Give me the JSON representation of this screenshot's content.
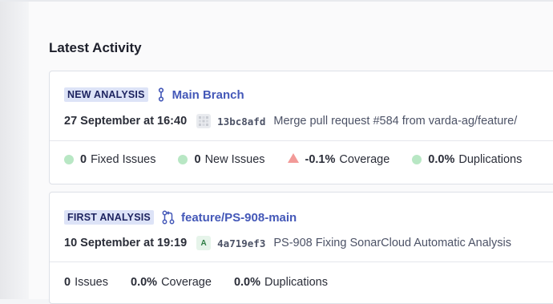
{
  "section_title": "Latest Activity",
  "colors": {
    "accent": "#4458b8",
    "badge_bg": "#dde3f7",
    "good": "#b8e7c4",
    "bad": "#f29a98"
  },
  "activities": [
    {
      "badge": "NEW ANALYSIS",
      "branch_icon": "main-branch-icon",
      "branch": "Main Branch",
      "date": "27 September at 16:40",
      "avatar": "identicon",
      "commit": "13bc8afd",
      "message": "Merge pull request #584 from varda-ag/feature/",
      "metrics": [
        {
          "icon": "green-dot-icon",
          "value": "0",
          "label": "Fixed Issues"
        },
        {
          "icon": "green-dot-icon",
          "value": "0",
          "label": "New Issues"
        },
        {
          "icon": "red-triangle-icon",
          "value": "-0.1%",
          "label": "Coverage"
        },
        {
          "icon": "green-dot-icon",
          "value": "0.0%",
          "label": "Duplications"
        }
      ]
    },
    {
      "badge": "FIRST ANALYSIS",
      "branch_icon": "pull-request-icon",
      "branch": "feature/PS-908-main",
      "date": "10 September at 19:19",
      "avatar": "A",
      "commit": "4a719ef3",
      "message": "PS-908 Fixing SonarCloud Automatic Analysis",
      "metrics": [
        {
          "value": "0",
          "label": "Issues"
        },
        {
          "value": "0.0%",
          "label": "Coverage"
        },
        {
          "value": "0.0%",
          "label": "Duplications"
        }
      ]
    }
  ]
}
